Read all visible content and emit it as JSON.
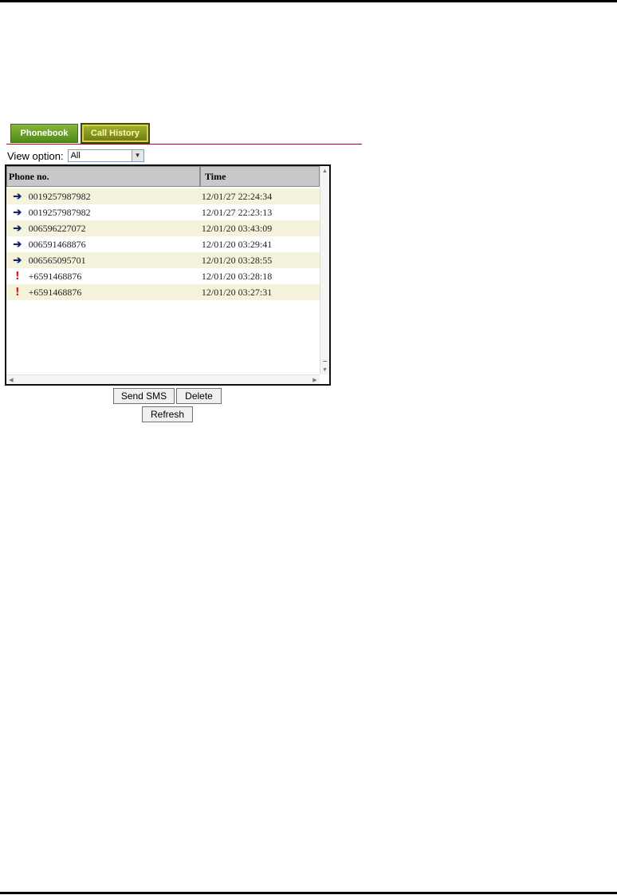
{
  "tabs": [
    {
      "label": "Phonebook",
      "active": false
    },
    {
      "label": "Call History",
      "active": true
    }
  ],
  "view_option": {
    "label": "View option:",
    "selected": "All"
  },
  "table": {
    "columns": [
      "Phone no.",
      "Time"
    ],
    "rows": [
      {
        "icon": "outgoing-call-icon",
        "phone": "0019257987982",
        "time": "12/01/27 22:24:34"
      },
      {
        "icon": "outgoing-call-icon",
        "phone": "0019257987982",
        "time": "12/01/27 22:23:13"
      },
      {
        "icon": "outgoing-call-icon",
        "phone": "006596227072",
        "time": "12/01/20 03:43:09"
      },
      {
        "icon": "outgoing-call-icon",
        "phone": "006591468876",
        "time": "12/01/20 03:29:41"
      },
      {
        "icon": "outgoing-call-icon",
        "phone": "006565095701",
        "time": "12/01/20 03:28:55"
      },
      {
        "icon": "missed-call-icon",
        "phone": "+6591468876",
        "time": "12/01/20 03:28:18"
      },
      {
        "icon": "missed-call-icon",
        "phone": "+6591468876",
        "time": "12/01/20 03:27:31"
      }
    ]
  },
  "buttons": {
    "send_sms": "Send SMS",
    "delete": "Delete",
    "refresh": "Refresh"
  },
  "colors": {
    "outgoing_icon": "#162563",
    "missed_icon": "#d42020",
    "row_alt": "#f5f3dc",
    "header": "#c8c8c8"
  }
}
